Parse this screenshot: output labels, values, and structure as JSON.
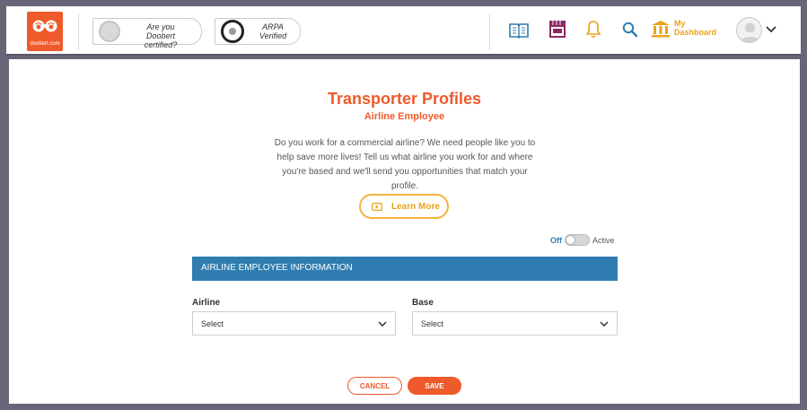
{
  "header": {
    "logo_text": "doobert.com",
    "certified_badge": "Are you\nDoobert certified?",
    "arpa_badge": "ARPA\nVerified",
    "dashboard_label_1": "My",
    "dashboard_label_2": "Dashboard",
    "icons": [
      "book-icon",
      "store-icon",
      "bell-icon",
      "search-icon",
      "bank-icon",
      "user-avatar-icon",
      "chevron-down-icon"
    ],
    "colors": {
      "brand": "#ef5a2b",
      "accent": "#e8a21a",
      "link": "#2f7db0"
    }
  },
  "main": {
    "title": "Transporter Profiles",
    "subtitle": "Airline Employee",
    "description": "Do you work for a commercial airline? We need people like you to help save more lives! Tell us what airline you work for and where you're based and we'll send you opportunities that match your profile.",
    "learn_more": "Learn More",
    "toggle_off": "Off",
    "toggle_on": "Active",
    "toggle_state": "off",
    "section_title": "AIRLINE EMPLOYEE INFORMATION",
    "airline_label": "Airline",
    "airline_value": "Select",
    "base_label": "Base",
    "base_value": "Select",
    "cancel": "CANCEL",
    "save": "SAVE"
  }
}
